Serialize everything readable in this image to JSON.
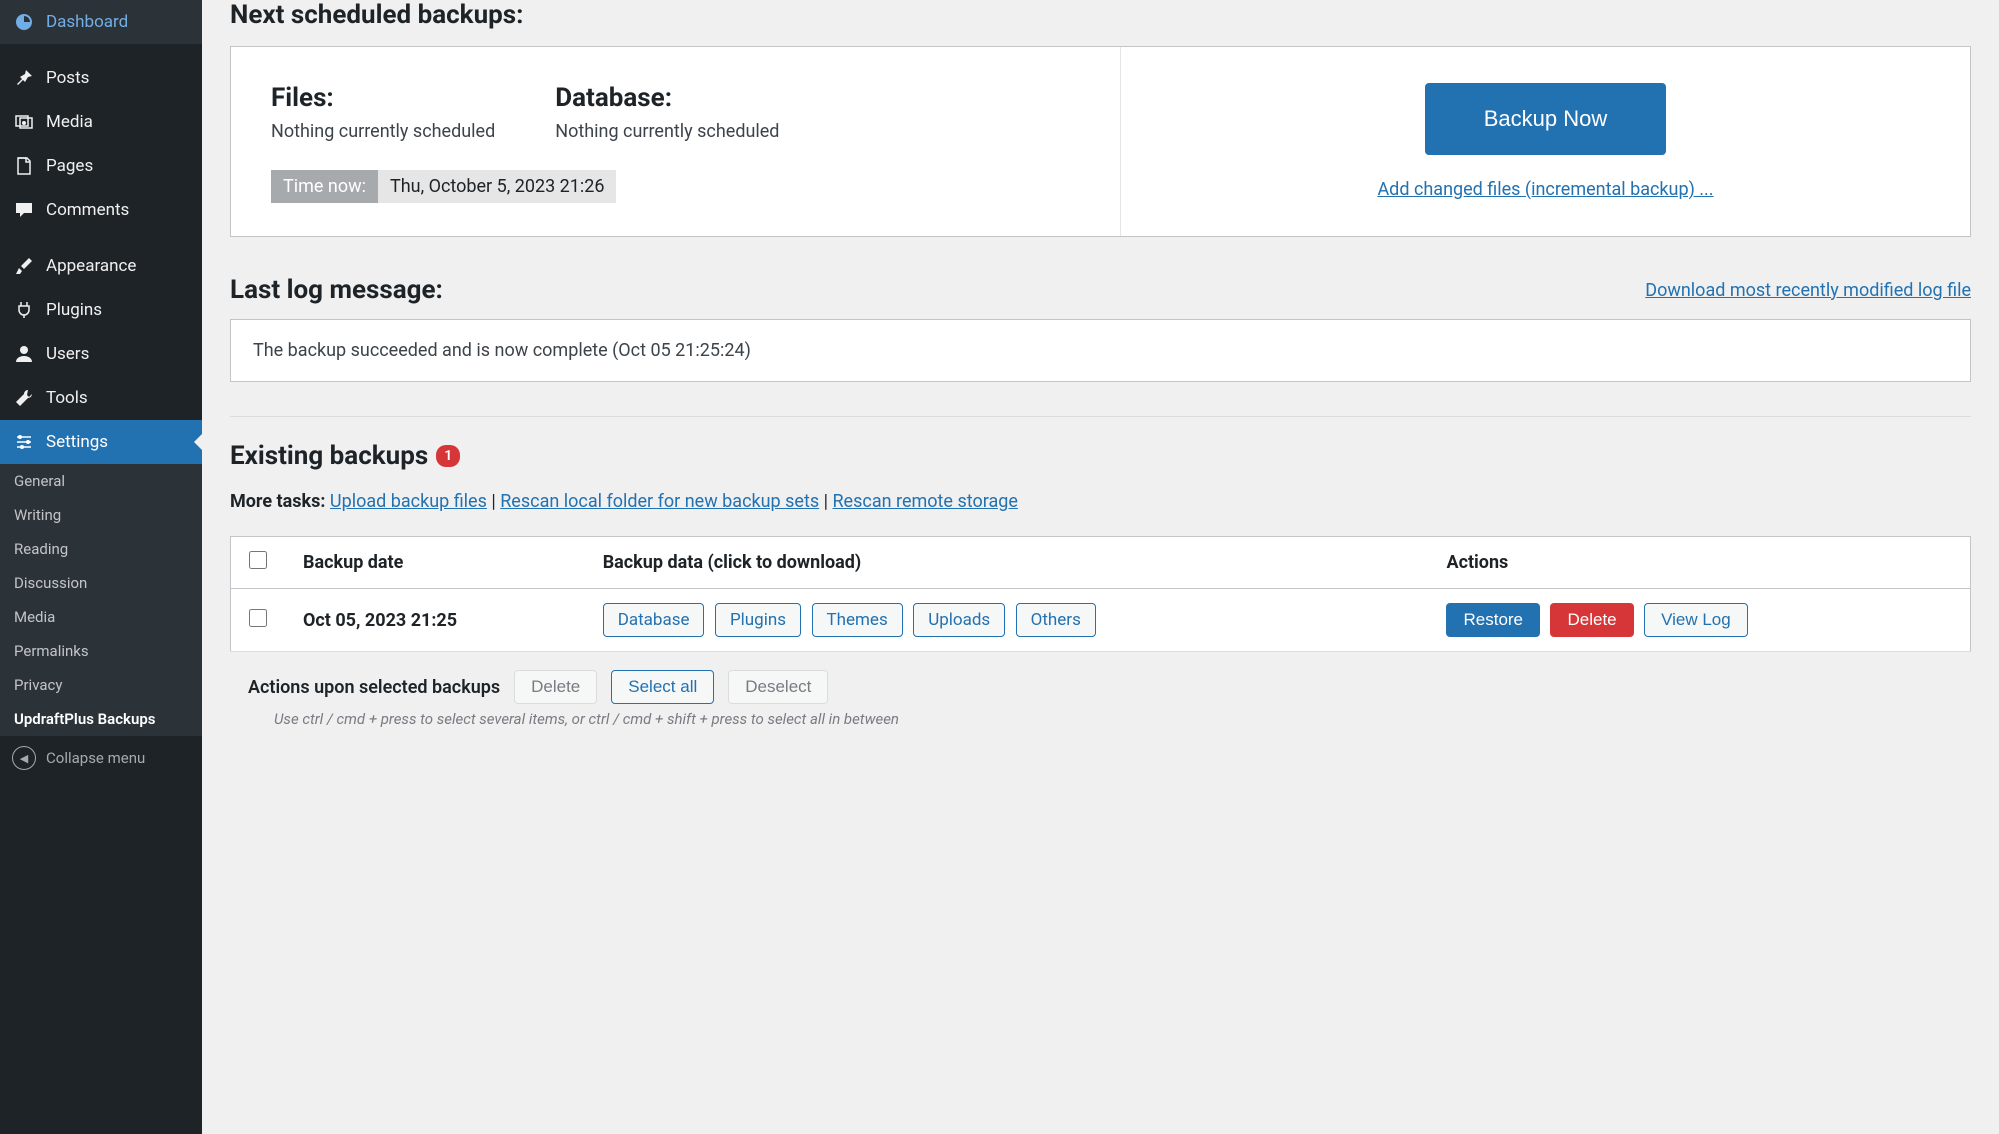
{
  "sidebar": {
    "items": [
      {
        "label": "Dashboard",
        "icon": "dashboard"
      },
      {
        "label": "Posts",
        "icon": "pin"
      },
      {
        "label": "Media",
        "icon": "media"
      },
      {
        "label": "Pages",
        "icon": "page"
      },
      {
        "label": "Comments",
        "icon": "comment"
      },
      {
        "label": "Appearance",
        "icon": "brush"
      },
      {
        "label": "Plugins",
        "icon": "plug"
      },
      {
        "label": "Users",
        "icon": "user"
      },
      {
        "label": "Tools",
        "icon": "wrench"
      },
      {
        "label": "Settings",
        "icon": "sliders"
      }
    ],
    "sub": [
      {
        "label": "General"
      },
      {
        "label": "Writing"
      },
      {
        "label": "Reading"
      },
      {
        "label": "Discussion"
      },
      {
        "label": "Media"
      },
      {
        "label": "Permalinks"
      },
      {
        "label": "Privacy"
      },
      {
        "label": "UpdraftPlus Backups"
      }
    ],
    "collapse": "Collapse menu"
  },
  "scheduled": {
    "title": "Next scheduled backups:",
    "files_label": "Files:",
    "files_value": "Nothing currently scheduled",
    "db_label": "Database:",
    "db_value": "Nothing currently scheduled",
    "time_now_label": "Time now:",
    "time_now_value": "Thu, October 5, 2023 21:26",
    "backup_now": "Backup Now",
    "incremental_link": "Add changed files (incremental backup) ..."
  },
  "log": {
    "title": "Last log message:",
    "download_link": "Download most recently modified log file",
    "message": "The backup succeeded and is now complete (Oct 05 21:25:24)"
  },
  "existing": {
    "title": "Existing backups",
    "badge": "1",
    "more_tasks_label": "More tasks:",
    "task_upload": "Upload backup files",
    "task_rescan_local": "Rescan local folder for new backup sets",
    "task_rescan_remote": "Rescan remote storage",
    "th_date": "Backup date",
    "th_data": "Backup data (click to download)",
    "th_actions": "Actions",
    "rows": [
      {
        "date": "Oct 05, 2023 21:25",
        "chips": [
          "Database",
          "Plugins",
          "Themes",
          "Uploads",
          "Others"
        ],
        "actions": {
          "restore": "Restore",
          "delete": "Delete",
          "viewlog": "View Log"
        }
      }
    ],
    "bulk_label": "Actions upon selected backups",
    "bulk_delete": "Delete",
    "bulk_select_all": "Select all",
    "bulk_deselect": "Deselect",
    "hint": "Use ctrl / cmd + press to select several items, or ctrl / cmd + shift + press to select all in between"
  }
}
